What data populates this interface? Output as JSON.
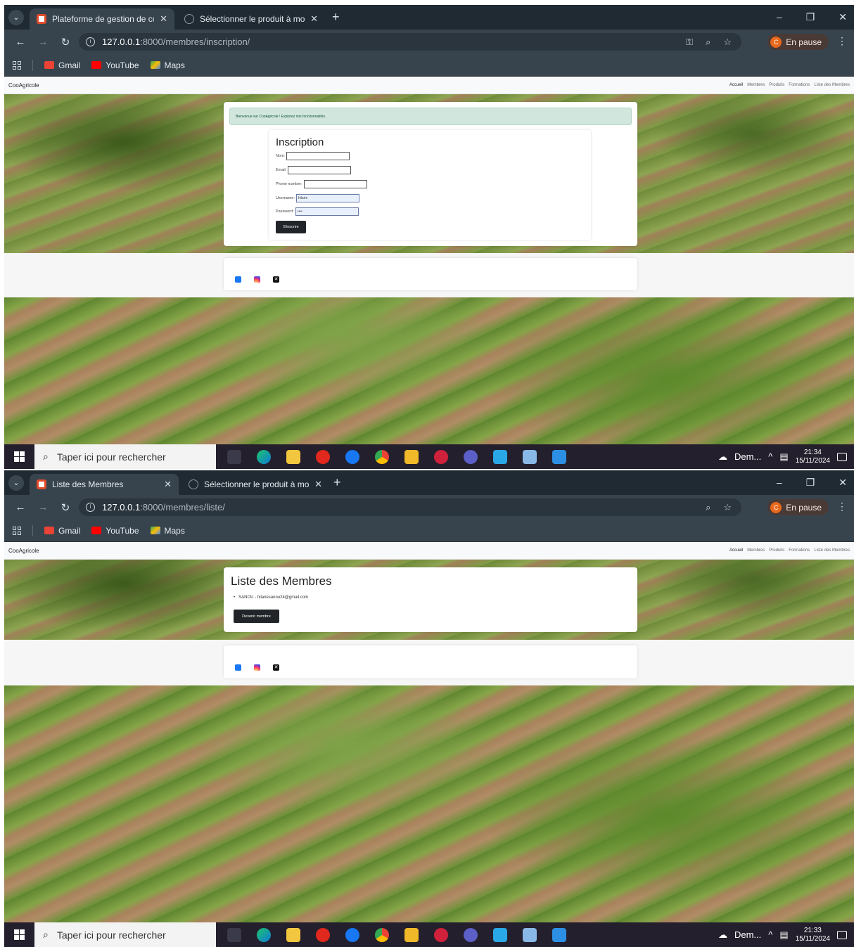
{
  "screen1": {
    "tabs": [
      {
        "title": "Plateforme de gestion de coopé",
        "active": true
      },
      {
        "title": "Sélectionner le produit à modif",
        "active": false
      }
    ],
    "url": {
      "host": "127.0.0.1",
      "rest": ":8000/membres/inscription/"
    },
    "profile_label": "En pause",
    "page": {
      "alert": "Bienvenue sur CooAgricole ! Explorez nos fonctionnalités.",
      "form_title": "Inscription",
      "fields": [
        {
          "label": "Nom:",
          "value": ""
        },
        {
          "label": "Email:",
          "value": ""
        },
        {
          "label": "Phone number:",
          "value": ""
        },
        {
          "label": "Username:",
          "value": "hilaire"
        },
        {
          "label": "Password:",
          "value": "••••"
        }
      ],
      "submit": "S'inscrire"
    },
    "clock": {
      "time": "21:34",
      "date": "15/11/2024"
    }
  },
  "screen2": {
    "tabs": [
      {
        "title": "Liste des Membres",
        "active": true
      },
      {
        "title": "Sélectionner le produit à modif",
        "active": false
      }
    ],
    "url": {
      "host": "127.0.0.1",
      "rest": ":8000/membres/liste/"
    },
    "profile_label": "En pause",
    "page": {
      "list_title": "Liste des Membres",
      "members": [
        "SANOU - hilairesanou24@gmail.com"
      ],
      "become_member": "Devenir membre"
    },
    "clock": {
      "time": "21:33",
      "date": "15/11/2024"
    }
  },
  "site": {
    "brand": "CooAgricole",
    "nav": [
      "Accueil",
      "Membres",
      "Produits",
      "Formations",
      "Liste des Membres"
    ]
  },
  "bookmarks": [
    "Gmail",
    "YouTube",
    "Maps"
  ],
  "taskbar": {
    "search_placeholder": "Taper ici pour rechercher",
    "weather": "Dem..."
  },
  "colors": {
    "accent_dark": "#212529",
    "alert_bg": "#d1e7dd",
    "chrome_bg": "#37444e"
  }
}
